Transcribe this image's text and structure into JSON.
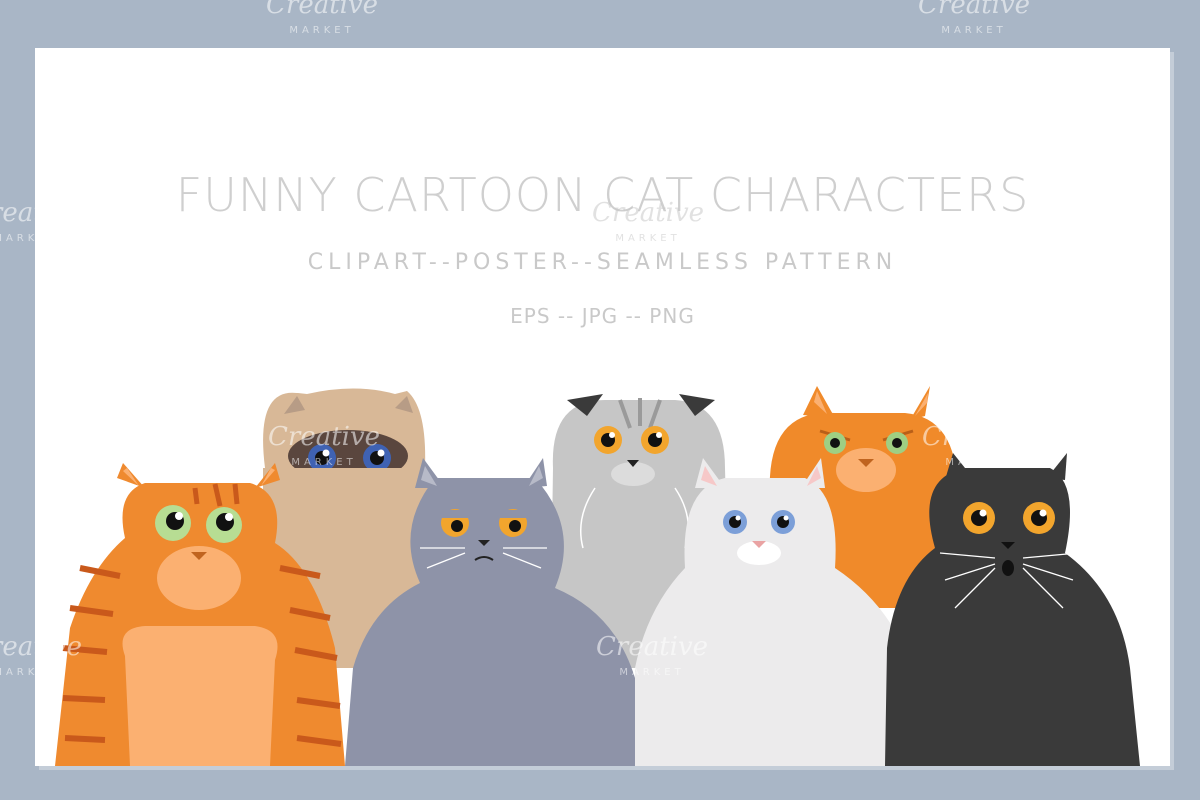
{
  "poster": {
    "title": "FUNNY CARTOON CAT CHARACTERS",
    "subtitle": "CLIPART--POSTER--SEAMLESS PATTERN",
    "formats": "EPS -- JPG -- PNG"
  },
  "watermark": {
    "brand": "Creative",
    "sub": "MARKET"
  },
  "colors": {
    "background": "#a9b6c6",
    "card": "#ffffff",
    "ginger": "#ef8a2f",
    "siamese": "#d8b897",
    "blue_grey": "#8e93a8",
    "silver": "#c4c4c4",
    "white_cat": "#ecebec",
    "orange": "#f08a2a",
    "black": "#3a3a3a"
  },
  "cats": [
    {
      "name": "ginger tabby",
      "icon": "ginger-tabby-cat-icon"
    },
    {
      "name": "siamese",
      "icon": "siamese-cat-icon"
    },
    {
      "name": "british shorthair",
      "icon": "grey-cat-icon"
    },
    {
      "name": "scottish fold",
      "icon": "silver-fold-cat-icon"
    },
    {
      "name": "white persian",
      "icon": "white-cat-icon"
    },
    {
      "name": "orange exotic",
      "icon": "orange-cat-icon"
    },
    {
      "name": "black persian",
      "icon": "black-cat-icon"
    }
  ]
}
